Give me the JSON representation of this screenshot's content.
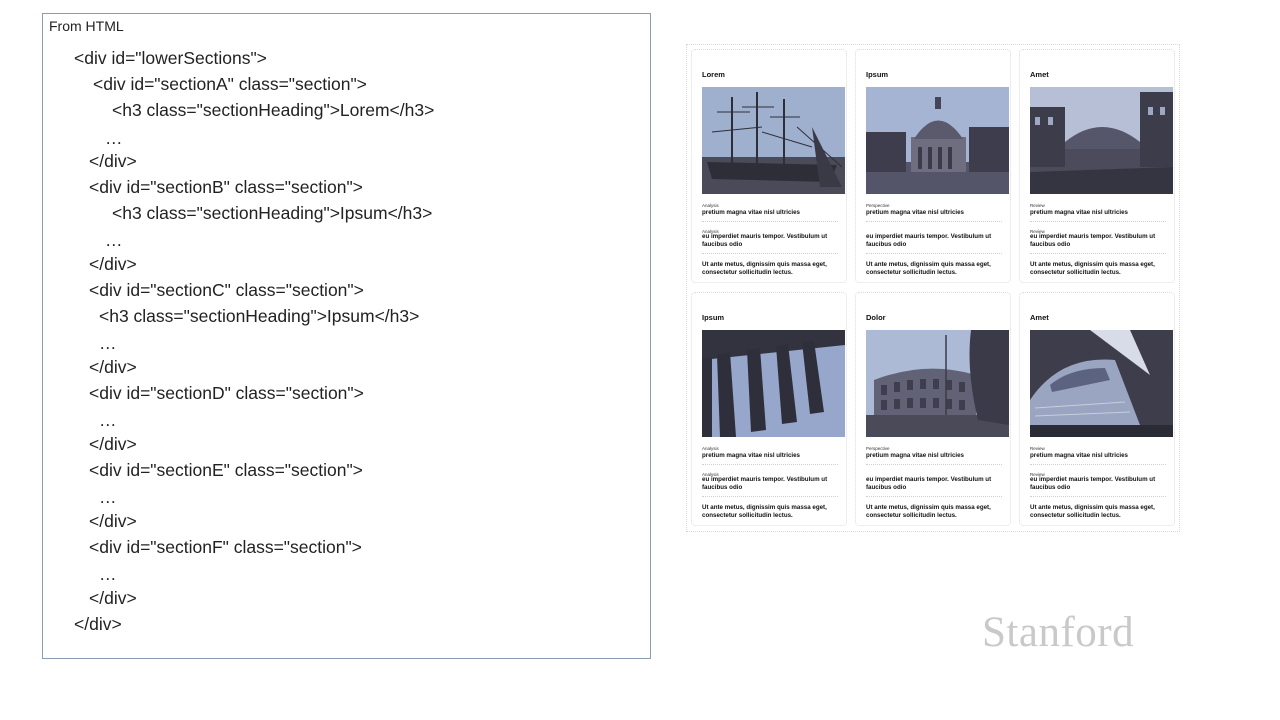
{
  "code_panel": {
    "title": "From HTML",
    "lines": [
      "<div id=\"lowerSections\">",
      "<div id=\"sectionA\" class=\"section\">",
      "<h3 class=\"sectionHeading\">Lorem</h3>",
      "…",
      "</div>",
      "<div id=\"sectionB\" class=\"section\">",
      "<h3 class=\"sectionHeading\">Ipsum</h3>",
      "…",
      "</div>",
      "<div id=\"sectionC\" class=\"section\">",
      "<h3 class=\"sectionHeading\">Ipsum</h3>",
      "…",
      "</div>",
      "<div id=\"sectionD\" class=\"section\">",
      "…",
      "</div>",
      "<div id=\"sectionE\" class=\"section\">",
      "…",
      "</div>",
      "<div id=\"sectionF\" class=\"section\">",
      "…",
      "</div>",
      "</div>"
    ]
  },
  "mockup": {
    "cards": [
      {
        "title": "Lorem",
        "image": "ships-photo",
        "label1": "Analysis",
        "line1": "pretium magna vitae nisl ultricies",
        "label2": "Analysis",
        "line2": "eu imperdiet mauris tempor. Vestibulum ut faucibus odio",
        "line3": "Ut ante metus, dignissim quis massa eget, consectetur sollicitudin lectus."
      },
      {
        "title": "Ipsum",
        "image": "dome-photo",
        "label1": "Perspective",
        "line1": "pretium magna vitae nisl ultricies",
        "label2": "",
        "line2": "eu imperdiet mauris tempor. Vestibulum ut faucibus odio",
        "line3": "Ut ante metus, dignissim quis massa eget, consectetur sollicitudin lectus."
      },
      {
        "title": "Amet",
        "image": "canal-photo",
        "label1": "Review",
        "line1": "pretium magna vitae nisl ultricies",
        "label2": "Review",
        "line2": "eu imperdiet mauris tempor. Vestibulum ut faucibus odio",
        "line3": "Ut ante metus, dignissim quis massa eget, consectetur sollicitudin lectus."
      },
      {
        "title": "Ipsum",
        "image": "columns-photo",
        "label1": "Analysis",
        "line1": "pretium magna vitae nisl ultricies",
        "label2": "Analysis",
        "line2": "eu imperdiet mauris tempor. Vestibulum ut faucibus odio",
        "line3": "Ut ante metus, dignissim quis massa eget, consectetur sollicitudin lectus."
      },
      {
        "title": "Dolor",
        "image": "colosseum-photo",
        "label1": "Perspective",
        "line1": "pretium magna vitae nisl ultricies",
        "label2": "",
        "line2": "eu imperdiet mauris tempor. Vestibulum ut faucibus odio",
        "line3": "Ut ante metus, dignissim quis massa eget, consectetur sollicitudin lectus."
      },
      {
        "title": "Amet",
        "image": "train-photo",
        "label1": "Review",
        "line1": "pretium magna vitae nisl ultricies",
        "label2": "Review",
        "line2": "eu imperdiet mauris tempor. Vestibulum ut faucibus odio",
        "line3": "Ut ante metus, dignissim quis massa eget, consectetur sollicitudin lectus."
      }
    ]
  },
  "logo": {
    "text": "Stanford"
  },
  "colors": {
    "panel_border": "#8a9bb5",
    "photo_dark": "#3c3c48",
    "photo_sky": "#8c9bbf",
    "logo": "#c9c9c9"
  }
}
